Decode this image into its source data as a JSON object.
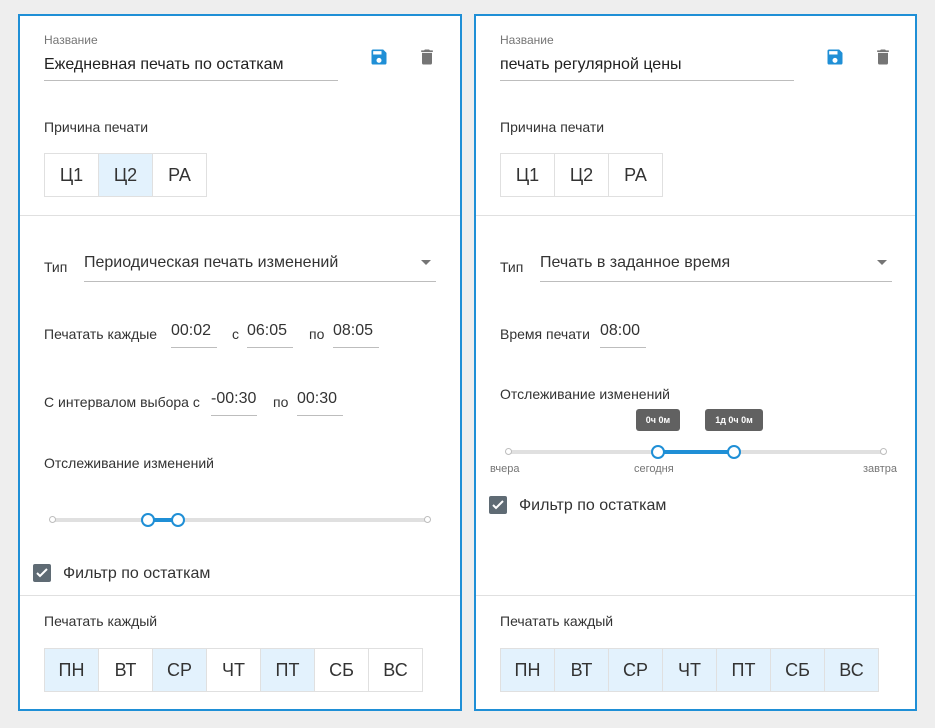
{
  "left": {
    "name_label": "Название",
    "name_value": "Ежедневная печать по остаткам",
    "reason_label": "Причина печати",
    "reasons": [
      {
        "label": "Ц1",
        "selected": false
      },
      {
        "label": "Ц2",
        "selected": true
      },
      {
        "label": "РА",
        "selected": false
      }
    ],
    "type_label": "Тип",
    "type_value": "Периодическая печать изменений",
    "print_every_label": "Печатать каждые",
    "print_every_value": "00:02",
    "from_label": "с",
    "from_value": "06:05",
    "to_label": "по",
    "to_value": "08:05",
    "interval_label": "С интервалом выбора с",
    "interval_from": "-00:30",
    "interval_to_label": "по",
    "interval_to": "00:30",
    "tracking_label": "Отслеживание изменений",
    "slider": {
      "low": 0.255,
      "high": 0.335
    },
    "filter_label": "Фильтр по остаткам",
    "filter_checked": true,
    "days_label": "Печатать каждый",
    "days": [
      {
        "label": "ПН",
        "selected": true
      },
      {
        "label": "ВТ",
        "selected": false
      },
      {
        "label": "СР",
        "selected": true
      },
      {
        "label": "ЧТ",
        "selected": false
      },
      {
        "label": "ПТ",
        "selected": true
      },
      {
        "label": "СБ",
        "selected": false
      },
      {
        "label": "ВС",
        "selected": false
      }
    ]
  },
  "right": {
    "name_label": "Название",
    "name_value": "печать регулярной цены",
    "reason_label": "Причина печати",
    "reasons": [
      {
        "label": "Ц1",
        "selected": false
      },
      {
        "label": "Ц2",
        "selected": false
      },
      {
        "label": "РА",
        "selected": false
      }
    ],
    "type_label": "Тип",
    "type_value": "Печать в заданное время",
    "print_time_label": "Время печати",
    "print_time_value": "08:00",
    "tracking_label": "Отслеживание изменений",
    "slider": {
      "low": 0.4,
      "high": 0.6
    },
    "tip_low": "0ч 0м",
    "tip_high": "1д 0ч 0м",
    "tick_yesterday": "вчера",
    "tick_today": "сегодня",
    "tick_tomorrow": "завтра",
    "filter_label": "Фильтр по остаткам",
    "filter_checked": true,
    "days_label": "Печатать каждый",
    "days": [
      {
        "label": "ПН",
        "selected": true
      },
      {
        "label": "ВТ",
        "selected": true
      },
      {
        "label": "СР",
        "selected": true
      },
      {
        "label": "ЧТ",
        "selected": true
      },
      {
        "label": "ПТ",
        "selected": true
      },
      {
        "label": "СБ",
        "selected": true
      },
      {
        "label": "ВС",
        "selected": true
      }
    ]
  },
  "colors": {
    "accent": "#1f8fd6",
    "selected_bg": "#e3f2fd",
    "checkbox": "#5f6b74"
  },
  "icons": {
    "save": "floppy-disk-icon",
    "delete": "trash-icon"
  }
}
